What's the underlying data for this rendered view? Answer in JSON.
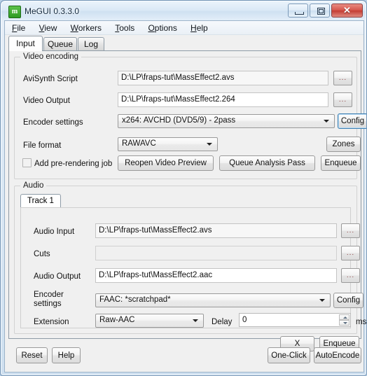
{
  "window": {
    "title": "MeGUI 0.3.3.0",
    "icon": "app-icon",
    "minimize_label": "Minimize",
    "maximize_label": "Maximize",
    "close_label": "✕"
  },
  "menubar": {
    "items": [
      {
        "label": "File",
        "mnemonic": "F"
      },
      {
        "label": "View",
        "mnemonic": "V"
      },
      {
        "label": "Workers",
        "mnemonic": "W"
      },
      {
        "label": "Tools",
        "mnemonic": "T"
      },
      {
        "label": "Options",
        "mnemonic": "O"
      },
      {
        "label": "Help",
        "mnemonic": "H"
      }
    ]
  },
  "tabs": [
    {
      "label": "Input",
      "active": true
    },
    {
      "label": "Queue",
      "active": false
    },
    {
      "label": "Log",
      "active": false
    }
  ],
  "video_group": {
    "legend": "Video encoding",
    "avisynth_label": "AviSynth Script",
    "avisynth_value": "D:\\LP\\fraps-tut\\MassEffect2.avs",
    "avisynth_browse": "...",
    "video_output_label": "Video Output",
    "video_output_value": "D:\\LP\\fraps-tut\\MassEffect2.264",
    "video_output_browse": "...",
    "encoder_settings_label": "Encoder settings",
    "encoder_settings_value": "x264: AVCHD (DVD5/9) - 2pass",
    "encoder_config_label": "Config",
    "file_format_label": "File format",
    "file_format_value": "RAWAVC",
    "zones_label": "Zones",
    "prerender_label": "Add pre-rendering job",
    "prerender_checked": false,
    "reopen_preview_label": "Reopen Video Preview",
    "queue_analysis_label": "Queue Analysis Pass",
    "enqueue_label": "Enqueue"
  },
  "audio_group": {
    "legend": "Audio",
    "track_tab_label": "Track 1",
    "audio_input_label": "Audio Input",
    "audio_input_value": "D:\\LP\\fraps-tut\\MassEffect2.avs",
    "audio_input_browse": "...",
    "cuts_label": "Cuts",
    "cuts_value": "",
    "cuts_browse": "...",
    "audio_output_label": "Audio Output",
    "audio_output_value": "D:\\LP\\fraps-tut\\MassEffect2.aac",
    "audio_output_browse": "...",
    "encoder_settings_label": "Encoder\nsettings",
    "encoder_settings_line1": "Encoder",
    "encoder_settings_line2": "settings",
    "encoder_settings_value": "FAAC: *scratchpad*",
    "encoder_config_label": "Config",
    "extension_label": "Extension",
    "extension_value": "Raw-AAC",
    "delay_label": "Delay",
    "delay_value": "0",
    "delay_unit": "ms",
    "remove_label": "X",
    "enqueue_label": "Enqueue"
  },
  "bottom_bar": {
    "reset_label": "Reset",
    "help_label": "Help",
    "one_click_label": "One-Click",
    "auto_encode_label": "AutoEncode"
  },
  "colors": {
    "window_frame": "#6f92b5",
    "client_bg": "#f0f0f0",
    "close_button": "#c33c33",
    "focus_border": "#3c7fb1"
  }
}
